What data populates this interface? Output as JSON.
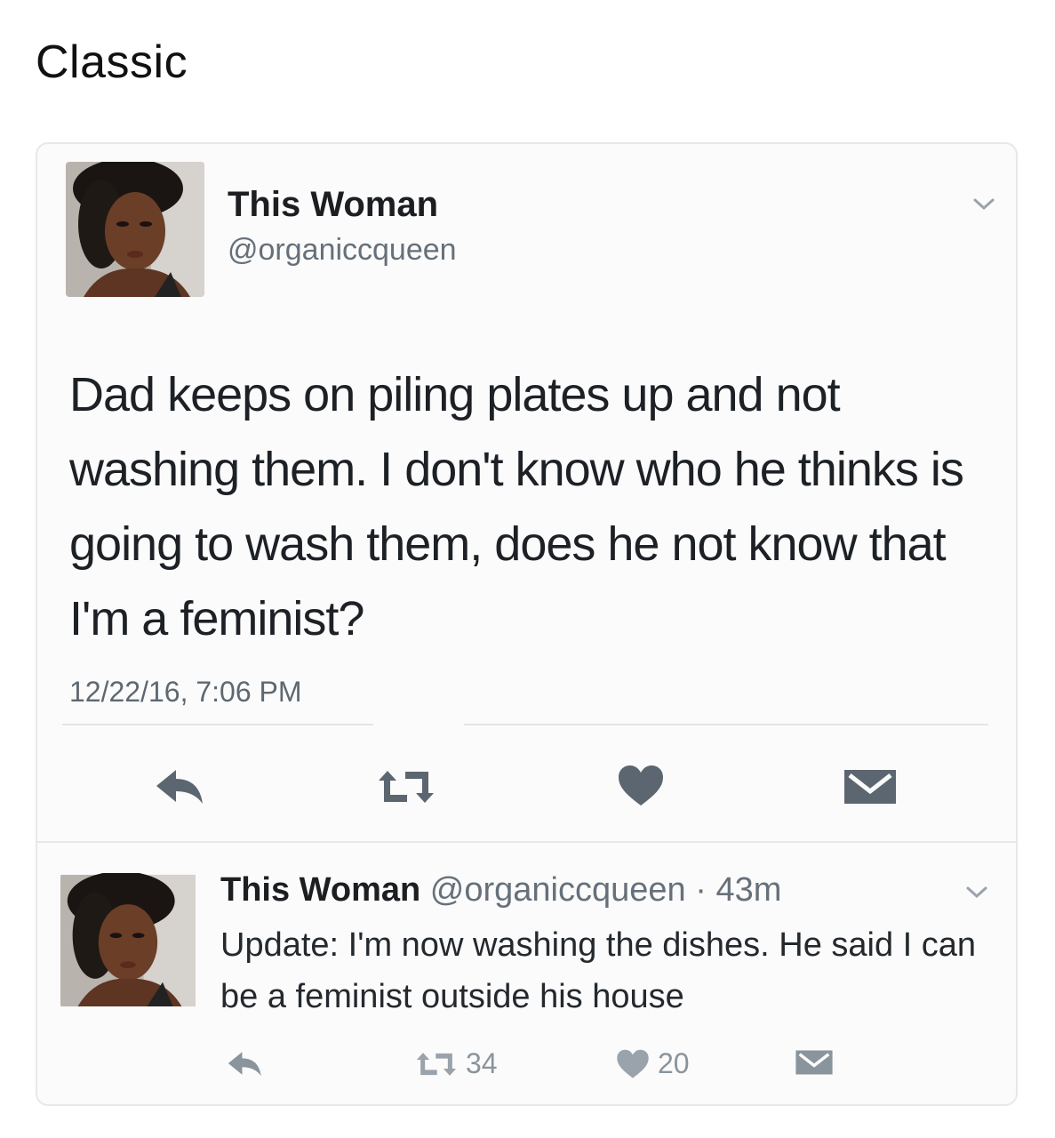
{
  "post_title": "Classic",
  "tweet": {
    "author_name": "This Woman",
    "author_handle": "@organiccqueen",
    "text": "Dad keeps on piling plates up and not washing them. I don't  know who he thinks is going to wash them, does he not know that I'm a feminist?",
    "timestamp": "12/22/16, 7:06 PM"
  },
  "reply": {
    "author_name": "This Woman",
    "author_handle": "@organiccqueen",
    "separator": "·",
    "age": "43m",
    "text": "Update: I'm now washing the dishes. He said I can be a feminist outside his house",
    "retweet_count": "34",
    "like_count": "20"
  },
  "icons": {
    "reply": "reply-arrow-icon",
    "retweet": "retweet-icon",
    "like": "heart-icon",
    "message": "envelope-icon",
    "menu": "chevron-down-icon"
  },
  "colors": {
    "icon_dark": "#5c6670",
    "icon_light": "#9aa3ab"
  }
}
